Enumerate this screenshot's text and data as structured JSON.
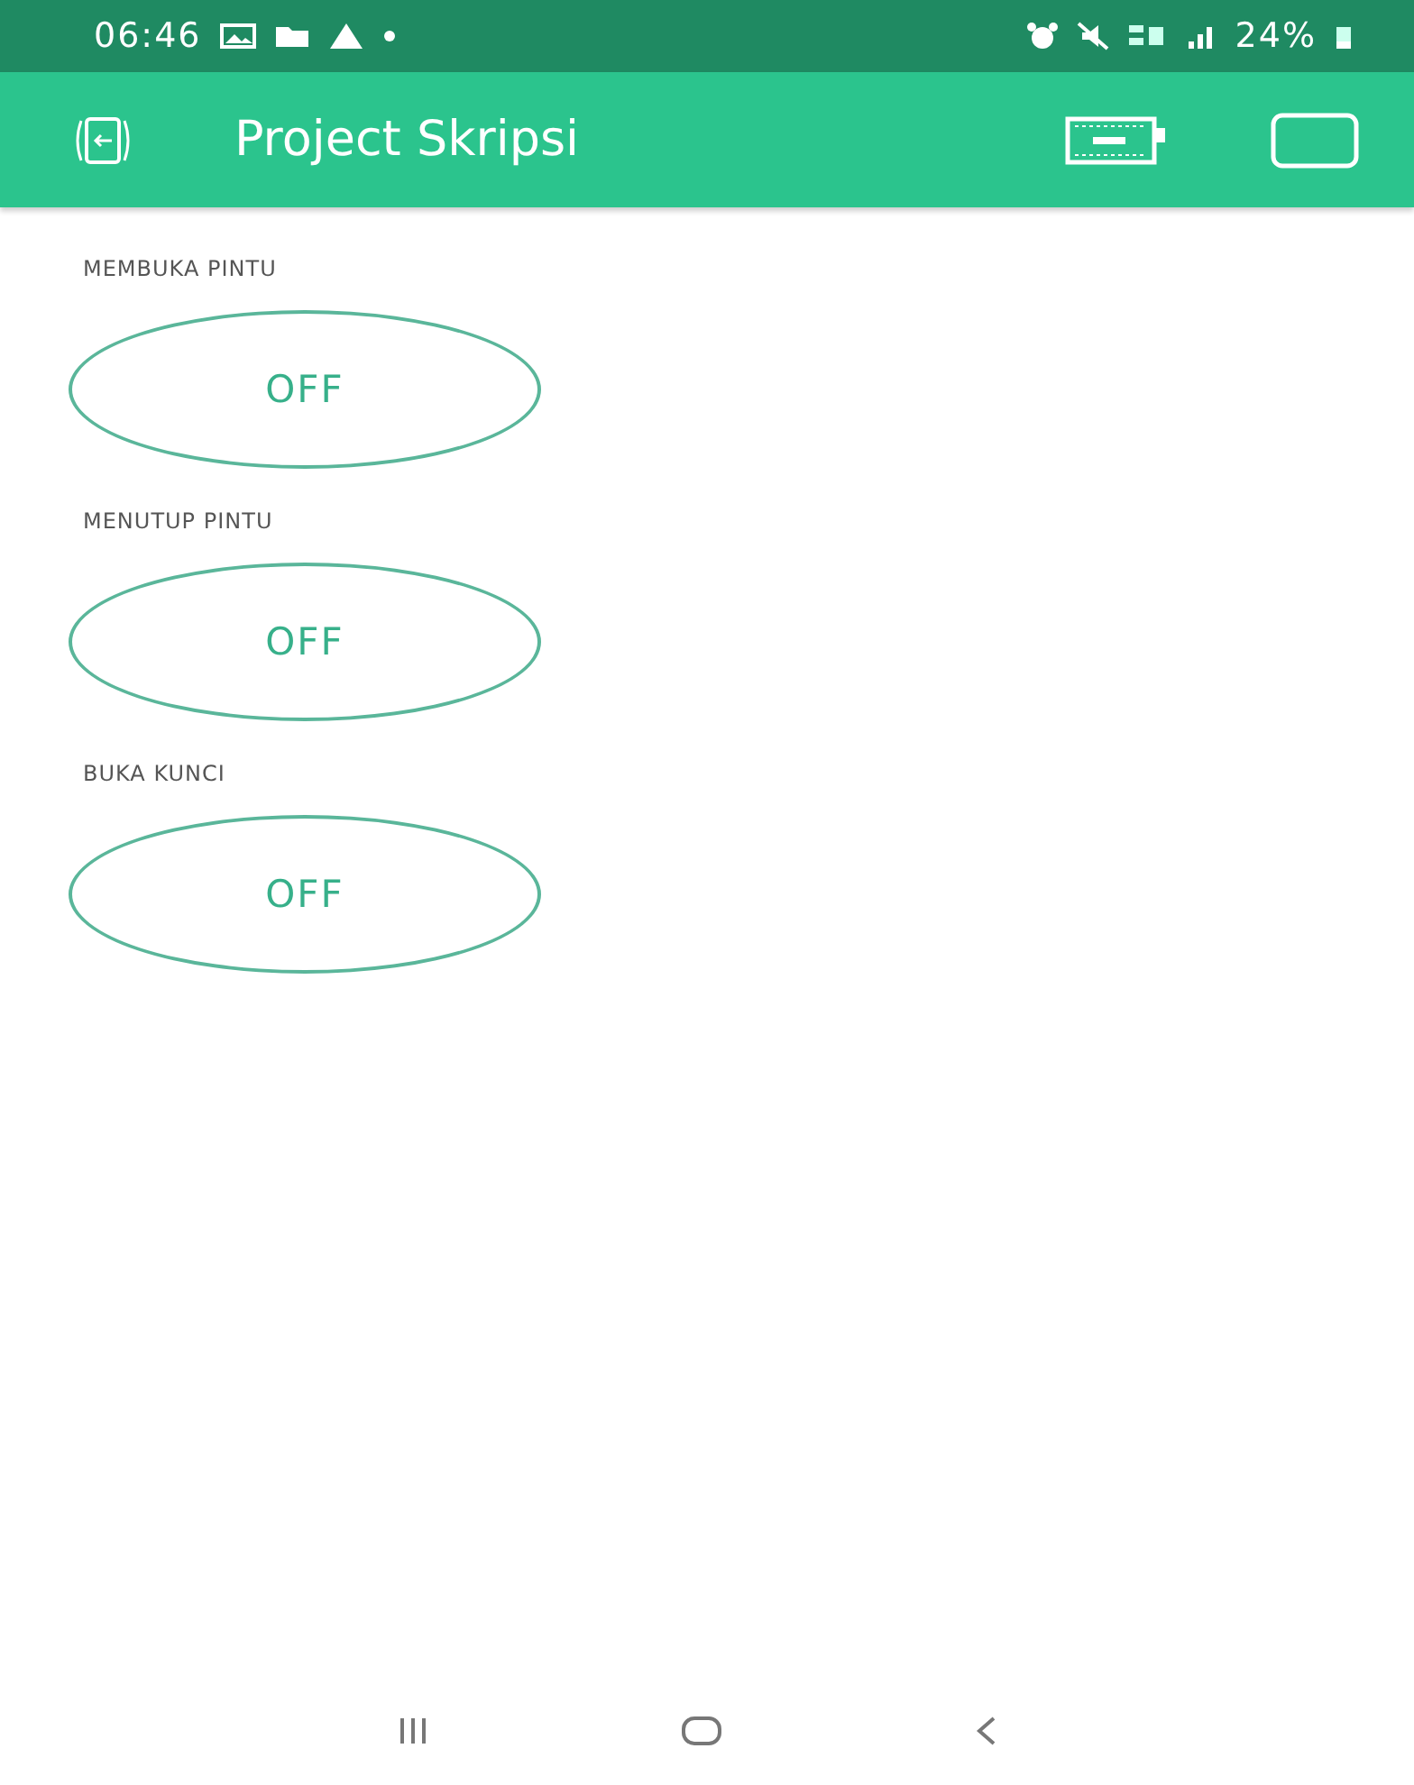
{
  "status_bar": {
    "time": "06:46",
    "battery": "24%"
  },
  "app_bar": {
    "title": "Project Skripsi"
  },
  "switches": [
    {
      "label": "MEMBUKA PINTU",
      "state_text": "OFF",
      "on": false
    },
    {
      "label": "MENUTUP PINTU",
      "state_text": "OFF",
      "on": false
    },
    {
      "label": "BUKA KUNCI",
      "state_text": "OFF",
      "on": false
    }
  ]
}
